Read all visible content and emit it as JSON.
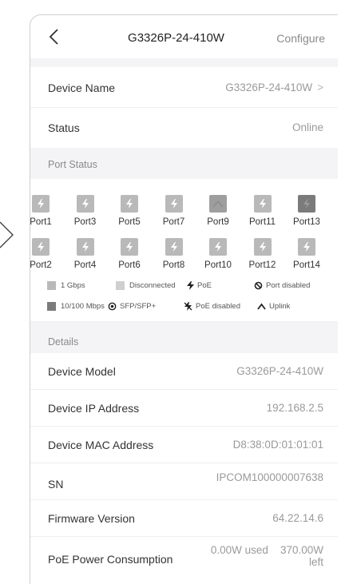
{
  "header": {
    "title": "G3326P-24-410W",
    "configure_label": "Configure"
  },
  "device": {
    "name_label": "Device Name",
    "name_value": "G3326P-24-410W",
    "status_label": "Status",
    "status_value": "Online"
  },
  "port_status": {
    "title": "Port Status",
    "top_row": [
      {
        "label": "Port1",
        "icon": "poe"
      },
      {
        "label": "Port3",
        "icon": "poe"
      },
      {
        "label": "Port5",
        "icon": "poe"
      },
      {
        "label": "Port7",
        "icon": "poe"
      },
      {
        "label": "Port9",
        "icon": "uplink"
      },
      {
        "label": "Port11",
        "icon": "poe"
      },
      {
        "label": "Port13",
        "icon": "poe-dark"
      }
    ],
    "bottom_row": [
      {
        "label": "Port2",
        "icon": "poe"
      },
      {
        "label": "Port4",
        "icon": "poe"
      },
      {
        "label": "Port6",
        "icon": "poe"
      },
      {
        "label": "Port8",
        "icon": "poe"
      },
      {
        "label": "Port10",
        "icon": "poe"
      },
      {
        "label": "Port12",
        "icon": "poe"
      },
      {
        "label": "Port14",
        "icon": "poe"
      }
    ]
  },
  "legend": {
    "gbps": "1 Gbps",
    "disconnected": "Disconnected",
    "poe": "PoE",
    "port_disabled": "Port disabled",
    "mbps": "10/100 Mbps",
    "sfp": "SFP/SFP+",
    "poe_disabled": "PoE disabled",
    "uplink": "Uplink"
  },
  "details": {
    "title": "Details",
    "model_label": "Device Model",
    "model_value": "G3326P-24-410W",
    "ip_label": "Device IP Address",
    "ip_value": "192.168.2.5",
    "mac_label": "Device MAC Address",
    "mac_value": "D8:38:0D:01:01:01",
    "sn_label": "SN",
    "sn_value": "IPCOM100000007638",
    "fw_label": "Firmware Version",
    "fw_value": "64.22.14.6",
    "poe_label": "PoE Power Consumption",
    "poe_used": "0.00W used",
    "poe_left_value": "370.00W",
    "poe_left_word": "left"
  },
  "colors": {
    "gbps": "#b9b9b9",
    "disconnected": "#cfcfcf",
    "mbps": "#7b7b7b",
    "background_gray": "#f4f4f6"
  }
}
